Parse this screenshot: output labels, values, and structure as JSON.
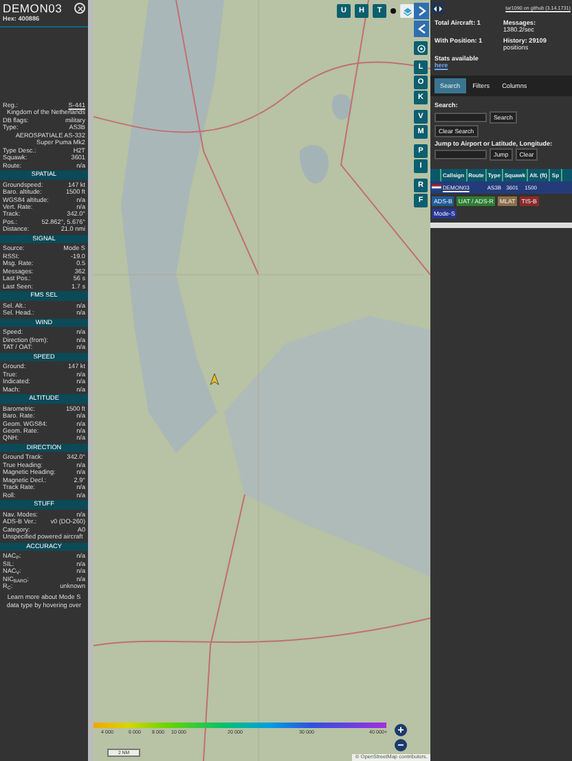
{
  "aircraft_panel": {
    "callsign": "DEMON03",
    "hex_label": "Hex:",
    "hex": "400886",
    "rows": [
      {
        "kind": "pair",
        "label": "Reg.:",
        "value": "S-441",
        "link": true
      },
      {
        "kind": "value",
        "value": "Kingdom of the Netherlands"
      },
      {
        "kind": "pair",
        "label": "DB flags:",
        "value": "military"
      },
      {
        "kind": "pair",
        "label": "Type:",
        "value": "AS3B"
      },
      {
        "kind": "value",
        "value": "AEROSPATIALE AS-332 Super Puma Mk2"
      },
      {
        "kind": "pair",
        "label": "Type Desc.:",
        "value": "H2T"
      },
      {
        "kind": "pair",
        "label": "Squawk:",
        "value": "3601"
      },
      {
        "kind": "pair",
        "label": "Route:",
        "value": "n/a"
      },
      {
        "kind": "section",
        "label": "SPATIAL"
      },
      {
        "kind": "pair",
        "label": "Groundspeed:",
        "value": "147 kt"
      },
      {
        "kind": "pair",
        "label": "Baro. altitude:",
        "value": "1500 ft"
      },
      {
        "kind": "pair",
        "label": "WGS84 altitude:",
        "value": "n/a"
      },
      {
        "kind": "pair",
        "label": "Vert. Rate:",
        "value": "n/a"
      },
      {
        "kind": "pair",
        "label": "Track:",
        "value": "342.0°"
      },
      {
        "kind": "pair",
        "label": "Pos.:",
        "value": "52.862°, 5.676°"
      },
      {
        "kind": "pair",
        "label": "Distance:",
        "value": "21.0 nmi"
      },
      {
        "kind": "section",
        "label": "SIGNAL"
      },
      {
        "kind": "pair",
        "label": "Source:",
        "value": "Mode S"
      },
      {
        "kind": "pair",
        "label": "RSSI:",
        "value": "-19.0"
      },
      {
        "kind": "pair",
        "label": "Msg. Rate:",
        "value": "0.5"
      },
      {
        "kind": "pair",
        "label": "Messages:",
        "value": "362"
      },
      {
        "kind": "pair",
        "label": "Last Pos.:",
        "value": "56 s"
      },
      {
        "kind": "pair",
        "label": "Last Seen:",
        "value": "1.7 s"
      },
      {
        "kind": "section",
        "label": "FMS SEL"
      },
      {
        "kind": "pair",
        "label": "Sel. Alt.:",
        "value": "n/a"
      },
      {
        "kind": "pair",
        "label": "Sel. Head.:",
        "value": "n/a"
      },
      {
        "kind": "section",
        "label": "WIND"
      },
      {
        "kind": "pair",
        "label": "Speed:",
        "value": "n/a"
      },
      {
        "kind": "pair",
        "label": "Direction (from):",
        "value": "n/a"
      },
      {
        "kind": "pair",
        "label": "TAT / OAT:",
        "value": "n/a"
      },
      {
        "kind": "section",
        "label": "SPEED"
      },
      {
        "kind": "pair",
        "label": "Ground:",
        "value": "147 kt"
      },
      {
        "kind": "pair",
        "label": "True:",
        "value": "n/a"
      },
      {
        "kind": "pair",
        "label": "Indicated:",
        "value": "n/a"
      },
      {
        "kind": "pair",
        "label": "Mach:",
        "value": "n/a"
      },
      {
        "kind": "section",
        "label": "ALTITUDE"
      },
      {
        "kind": "pair",
        "label": "Barometric:",
        "value": "1500 ft"
      },
      {
        "kind": "pair",
        "label": "Baro. Rate:",
        "value": "n/a"
      },
      {
        "kind": "pair",
        "label": "Geom. WGS84:",
        "value": "n/a"
      },
      {
        "kind": "pair",
        "label": "Geom. Rate:",
        "value": "n/a"
      },
      {
        "kind": "pair",
        "label": "QNH:",
        "value": "n/a"
      },
      {
        "kind": "section",
        "label": "DIRECTION"
      },
      {
        "kind": "pair",
        "label": "Ground Track:",
        "value": "342.0°"
      },
      {
        "kind": "pair",
        "label": "True Heading:",
        "value": "n/a"
      },
      {
        "kind": "pair",
        "label": "Magnetic Heading:",
        "value": "n/a"
      },
      {
        "kind": "pair",
        "label": "Magnetic Decl.:",
        "value": "2.9°"
      },
      {
        "kind": "pair",
        "label": "Track Rate:",
        "value": "n/a"
      },
      {
        "kind": "pair",
        "label": "Roll:",
        "value": "n/a"
      },
      {
        "kind": "section",
        "label": "STUFF"
      },
      {
        "kind": "pair",
        "label": "Nav. Modes:",
        "value": "n/a"
      },
      {
        "kind": "pair",
        "label": "ADS-B Ver.:",
        "value": "v0 (DO-260)"
      },
      {
        "kind": "pair",
        "label": "Category:",
        "value": "A0"
      },
      {
        "kind": "note",
        "value": "Unspecified powered aircraft"
      },
      {
        "kind": "section",
        "label": "ACCURACY"
      },
      {
        "kind": "pair",
        "label": "NAC$_{P}$:",
        "value": "n/a"
      },
      {
        "kind": "pair",
        "label": "SIL:",
        "value": "n/a"
      },
      {
        "kind": "pair",
        "label": "NAC$_{V}$:",
        "value": "n/a"
      },
      {
        "kind": "pair",
        "label": "NIC$_{BARO}$:",
        "value": "n/a"
      },
      {
        "kind": "pair",
        "label": "R$_{C}$:",
        "value": "unknown"
      },
      {
        "kind": "footer",
        "value": "Learn more about Mode S data type by hovering over"
      }
    ]
  },
  "map": {
    "top_buttons": [
      "U",
      "H",
      "T"
    ],
    "side_groups": [
      [
        "L",
        "O",
        "K"
      ],
      [
        "V",
        "M"
      ],
      [
        "P",
        "I"
      ],
      [
        "R",
        "F"
      ]
    ],
    "altitude_labels": [
      "4 000",
      "6 000",
      "8 000",
      "10 000",
      "20 000",
      "30 000",
      "40 000+"
    ],
    "scale": "2 NM",
    "zoom_in": "+",
    "zoom_out": "−",
    "attribution": "© OpenStreetMap contributors."
  },
  "side_panel": {
    "version_link": "tar1090 on github (3.14.1731)",
    "total_aircraft": "Total Aircraft: 1",
    "messages_label": "Messages:",
    "messages": "1380.2/sec",
    "with_position": "With Position: 1",
    "history_label": "History: 29109",
    "history": "positions",
    "stats_text": "Stats available",
    "stats_link": "here",
    "tabs": [
      {
        "label": "Search",
        "selected": true
      },
      {
        "label": "Filters",
        "selected": false
      },
      {
        "label": "Columns",
        "selected": false
      }
    ],
    "search_label": "Search:",
    "search_button": "Search",
    "clear_search_button": "Clear Search",
    "jump_label": "Jump to Airport or Latitude, Longitude:",
    "jump_button": "Jump",
    "clear_button": "Clear",
    "columns": [
      "Callsign",
      "Route",
      "Type",
      "Squawk",
      "Alt. (ft)",
      "Sp"
    ],
    "rows": [
      {
        "cells": [
          "DEMON03",
          "",
          "AS3B",
          "3601",
          "1500",
          ""
        ],
        "selected": true
      }
    ],
    "legend": [
      {
        "label": "ADS-B",
        "color": "#1f5c99"
      },
      {
        "label": "UAT / ADS-R",
        "color": "#2e7d32"
      },
      {
        "label": "MLAT",
        "color": "#8d6e4a"
      },
      {
        "label": "TIS-B",
        "color": "#8b2a2a"
      },
      {
        "label": "Mode-S",
        "color": "#283593"
      }
    ]
  }
}
